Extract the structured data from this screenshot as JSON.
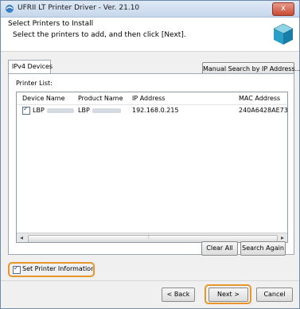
{
  "window": {
    "title": "UFRII LT Printer Driver - Ver. 21.10",
    "close_glyph": "x"
  },
  "header": {
    "title": "Select Printers to Install",
    "subtitle": "Select the printers to add, and then click [Next]."
  },
  "tab": {
    "label": "IPv4 Devices"
  },
  "manual_search": {
    "label": "Manual Search by IP Address..."
  },
  "list": {
    "label": "Printer List:",
    "columns": [
      "Device Name",
      "Product Name",
      "IP Address",
      "MAC Address"
    ],
    "rows": [
      {
        "checked": true,
        "device": "LBP",
        "product": "LBP",
        "ip": "192.168.0.215",
        "mac": "240A6428AE73"
      }
    ]
  },
  "buttons": {
    "clear_all": "Clear All",
    "search_again": "Search Again",
    "back": "< Back",
    "next": "Next >",
    "cancel": "Cancel"
  },
  "set_info": {
    "label": "Set Printer Information",
    "checked": true
  },
  "colors": {
    "highlight": "#e8962a",
    "title_bar": "#c6d7ec",
    "close": "#c84a34"
  },
  "icons": {
    "title": "printer-driver-icon",
    "header": "installer-box-icon"
  }
}
